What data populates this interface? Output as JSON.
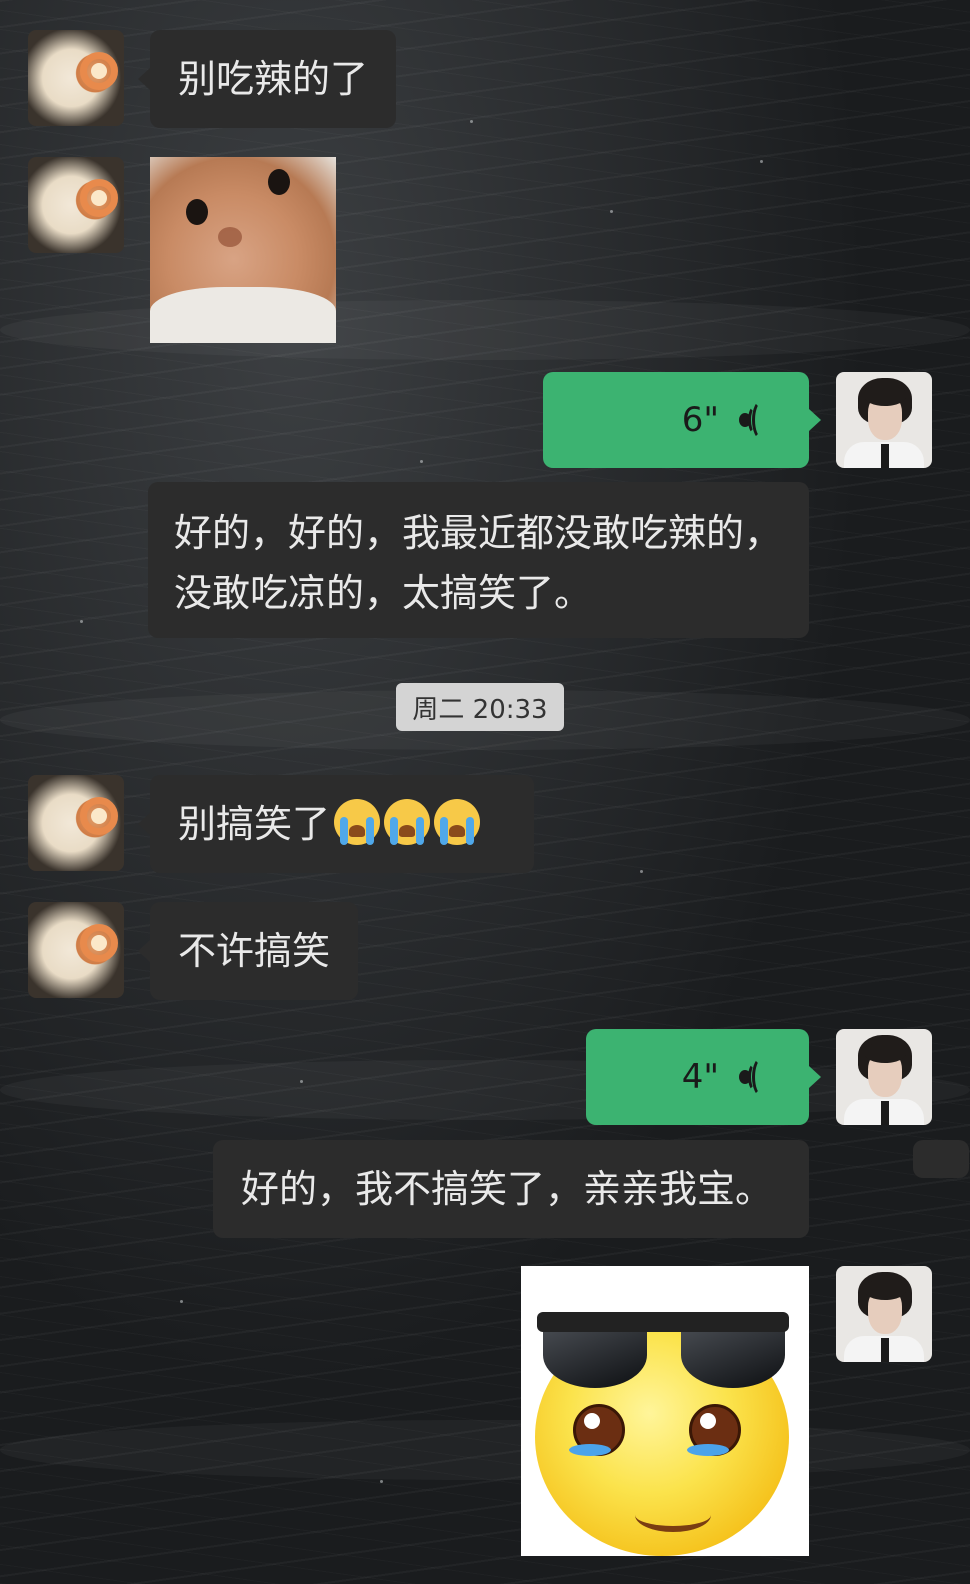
{
  "messages": [
    {
      "side": "left",
      "type": "text",
      "text": "别吃辣的了"
    },
    {
      "side": "left",
      "type": "sticker",
      "sticker": "hamster-face-sticker"
    },
    {
      "side": "right",
      "type": "voice",
      "duration": "6\""
    },
    {
      "side": "right",
      "type": "text",
      "line1": "好的，好的，我最近都没敢吃辣的，",
      "line2": "没敢吃凉的，太搞笑了。"
    },
    {
      "side": "left",
      "type": "text",
      "text": "别搞笑了",
      "emoji": [
        "loudly-crying-face",
        "loudly-crying-face",
        "loudly-crying-face"
      ]
    },
    {
      "side": "left",
      "type": "text",
      "text": "不许搞笑"
    },
    {
      "side": "right",
      "type": "voice",
      "duration": "4\""
    },
    {
      "side": "right",
      "type": "text",
      "text": "好的，我不搞笑了，亲亲我宝。"
    },
    {
      "side": "right",
      "type": "sticker",
      "sticker": "crying-sunglasses-smiley-sticker"
    }
  ],
  "timestamp": "周二 20:33",
  "colors": {
    "voice_bubble": "#3cb371",
    "text_bubble": "#2c2c2c",
    "timestamp_bg": "#d4d4d4"
  }
}
